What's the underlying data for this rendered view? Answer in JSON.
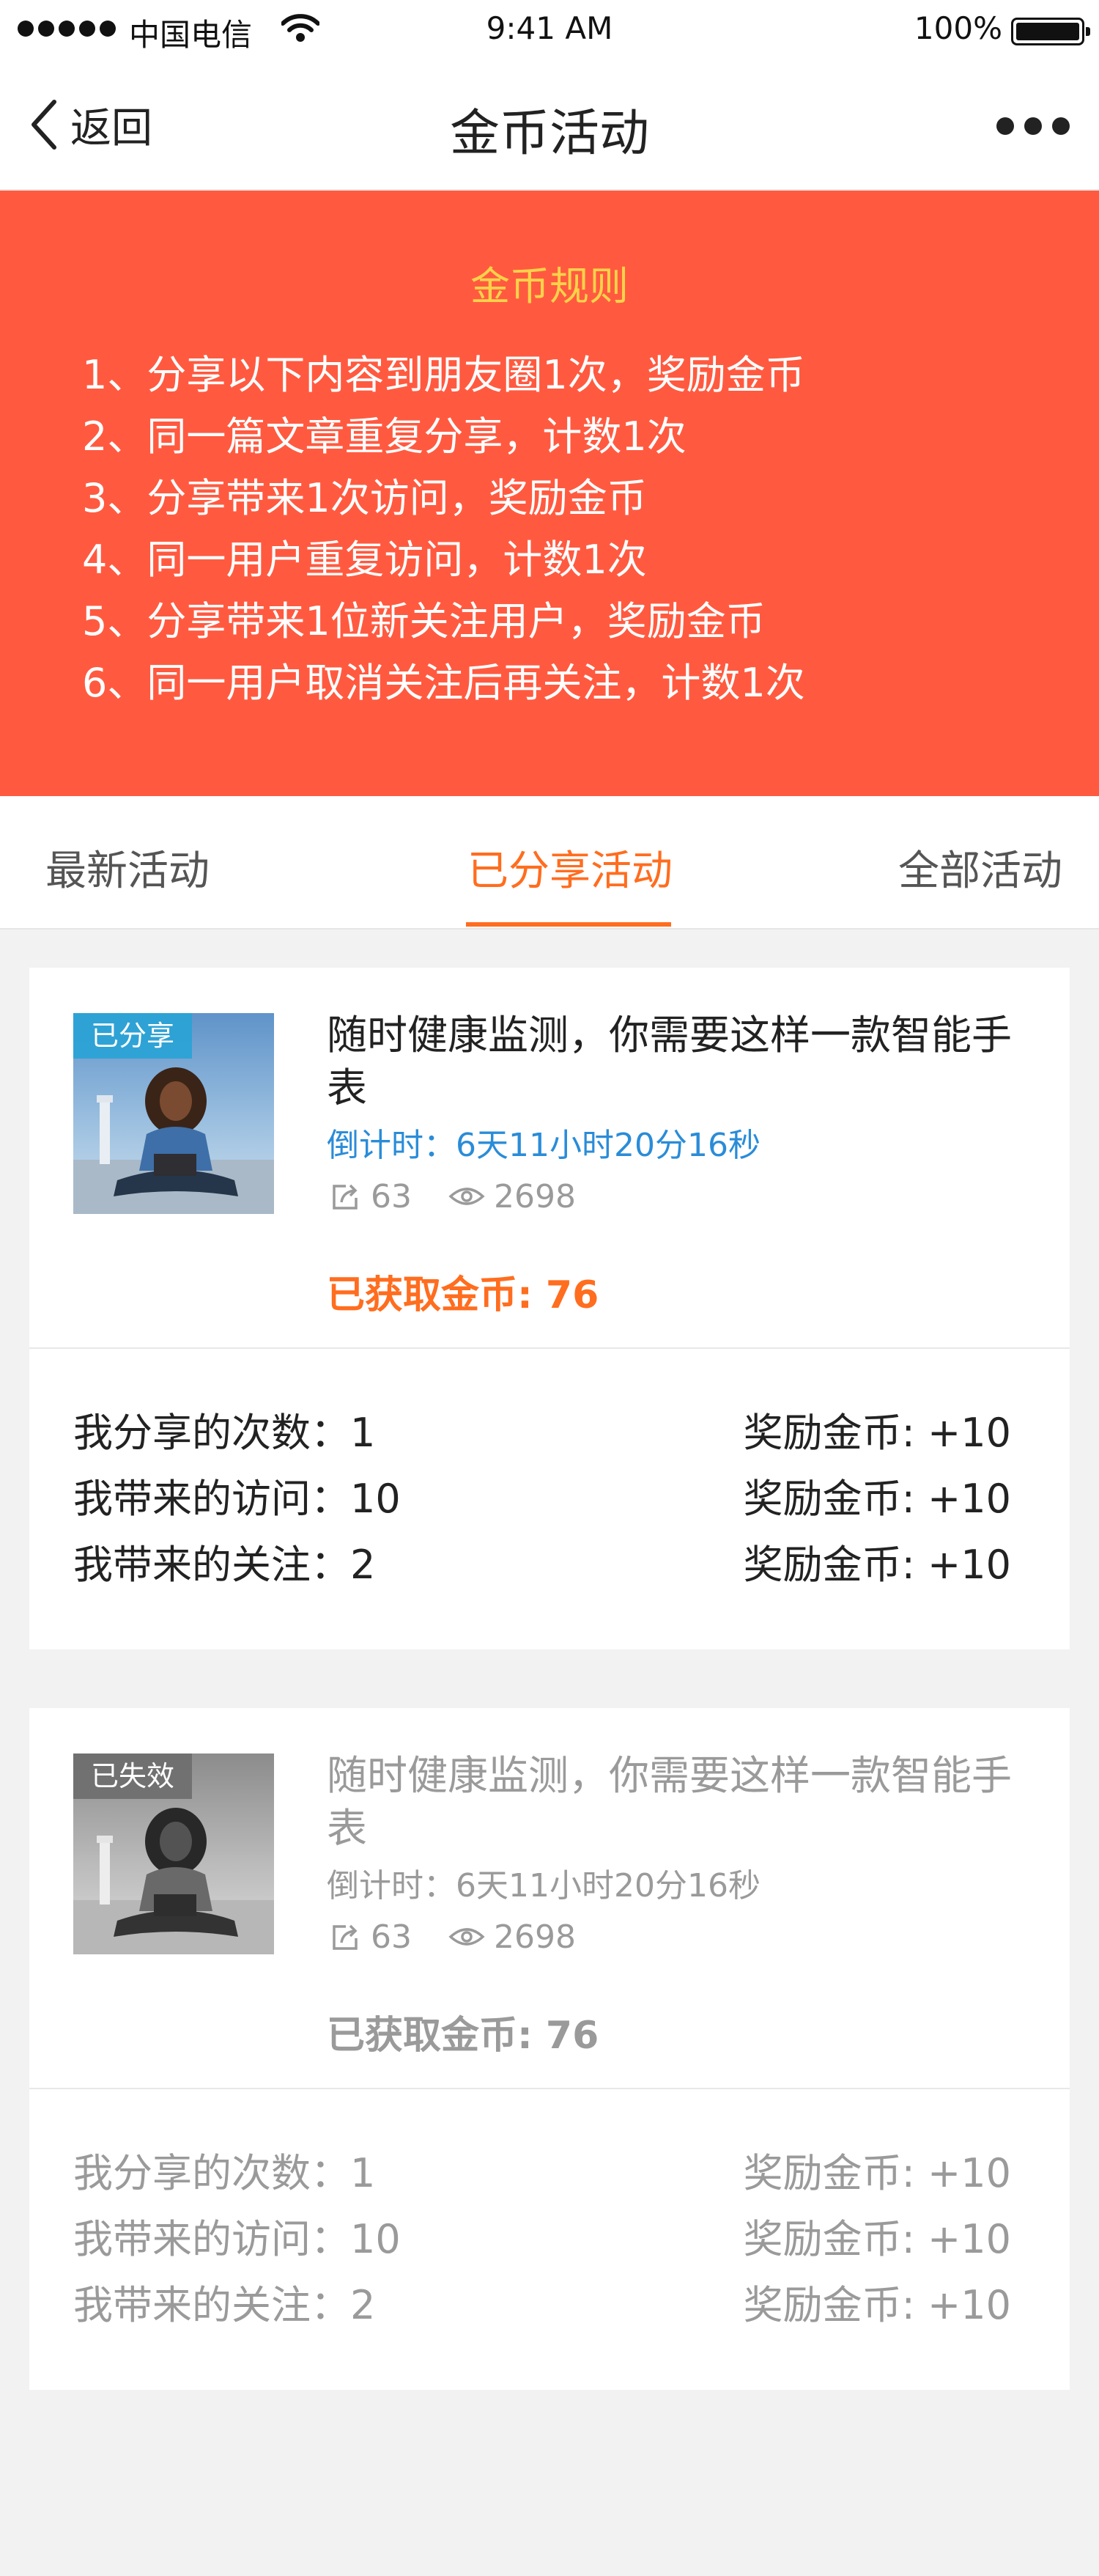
{
  "status_bar": {
    "carrier": "中国电信",
    "time": "9:41 AM",
    "battery": "100%",
    "battery_level": 1.0
  },
  "nav": {
    "back_label": "返回",
    "title": "金币活动"
  },
  "rules": {
    "title": "金币规则",
    "items": [
      "1、分享以下内容到朋友圈1次，奖励金币",
      "2、同一篇文章重复分享，计数1次",
      "3、分享带来1次访问，奖励金币",
      "4、同一用户重复访问，计数1次",
      "5、分享带来1位新关注用户，奖励金币",
      "6、同一用户取消关注后再关注，计数1次"
    ]
  },
  "tabs": [
    {
      "label": "最新活动",
      "active": false
    },
    {
      "label": "已分享活动",
      "active": true
    },
    {
      "label": "全部活动",
      "active": false
    }
  ],
  "activities": [
    {
      "badge": "已分享",
      "title": "随时健康监测，你需要这样一款智能手表",
      "countdown": "倒计时：6天11小时20分16秒",
      "shares": "63",
      "views": "2698",
      "earned": "已获取金币: 76",
      "stats": [
        {
          "label": "我分享的次数：1",
          "reward": "奖励金币: +10"
        },
        {
          "label": "我带来的访问：10",
          "reward": "奖励金币: +10"
        },
        {
          "label": "我带来的关注：2",
          "reward": "奖励金币: +10"
        }
      ]
    },
    {
      "badge": "已失效",
      "title": "随时健康监测，你需要这样一款智能手表",
      "countdown": "倒计时：6天11小时20分16秒",
      "shares": "63",
      "views": "2698",
      "earned": "已获取金币: 76",
      "stats": [
        {
          "label": "我分享的次数：1",
          "reward": "奖励金币: +10"
        },
        {
          "label": "我带来的访问：10",
          "reward": "奖励金币: +10"
        },
        {
          "label": "我带来的关注：2",
          "reward": "奖励金币: +10"
        }
      ]
    }
  ],
  "colors": {
    "banner": "#ff5a40",
    "rules_title": "#ffd24a",
    "accent": "#ff6d1f",
    "countdown": "#2a8cd8",
    "muted": "#9a9a9a",
    "badge_shared": "#29a3d6",
    "badge_expired": "#777777"
  },
  "icons": [
    "signal-icon",
    "wifi-icon",
    "battery-icon",
    "chevron-left-icon",
    "more-icon",
    "share-icon",
    "eye-icon"
  ]
}
